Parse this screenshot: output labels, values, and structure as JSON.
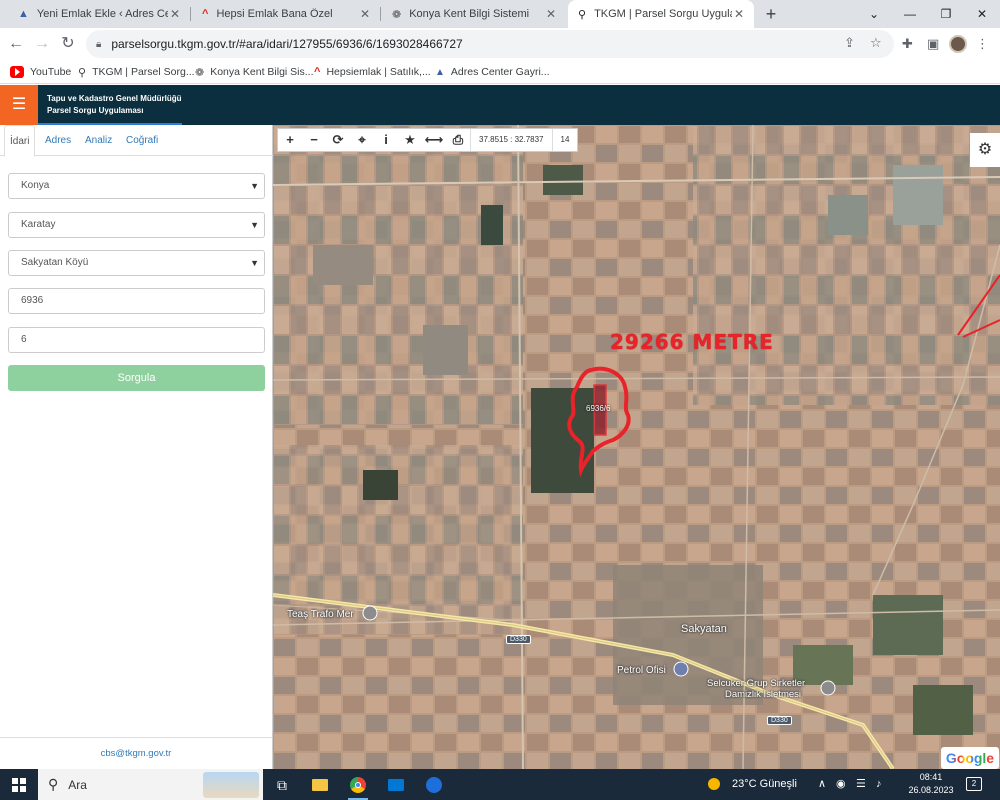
{
  "browser": {
    "tabs": [
      {
        "title": "Yeni Emlak Ekle ‹ Adres Center Gayri",
        "icon": "triangle-logo-icon",
        "active": false
      },
      {
        "title": "Hepsi Emlak Bana Özel",
        "icon": "hepsiemlak-icon",
        "active": false
      },
      {
        "title": "Konya Kent Bilgi Sistemi",
        "icon": "konya-logo-icon",
        "active": false
      },
      {
        "title": "TKGM | Parsel Sorgu Uygulaması",
        "icon": "map-pin-icon",
        "active": true
      }
    ],
    "new_tab": "+",
    "window_controls": {
      "dropdown": "⌄",
      "minimize": "—",
      "restore": "❐",
      "close": "✕"
    },
    "url": "parselsorgu.tkgm.gov.tr/#ara/idari/127955/6936/6/1693028466727",
    "bookmarks": [
      {
        "label": "YouTube",
        "icon": "youtube-icon"
      },
      {
        "label": "TKGM | Parsel Sorg...",
        "icon": "map-pin-icon"
      },
      {
        "label": "Konya Kent Bilgi Sis...",
        "icon": "konya-logo-icon"
      },
      {
        "label": "Hepsiemlak | Satılık,...",
        "icon": "hepsiemlak-icon"
      },
      {
        "label": "Adres Center Gayri...",
        "icon": "triangle-logo-icon"
      }
    ]
  },
  "app": {
    "title_line1": "Tapu ve Kadastro Genel Müdürlüğü",
    "title_line2": "Parsel Sorgu Uygulaması",
    "menu_icon": "☰",
    "colors": {
      "header": "#0b2f3f",
      "menu": "#f26522",
      "query_button": "#8fd19e",
      "annotation": "#e8232a"
    }
  },
  "sidebar": {
    "tabs": [
      "İdari",
      "Adres",
      "Analiz",
      "Coğrafi"
    ],
    "active_tab": "İdari",
    "province": "Konya",
    "district": "Karatay",
    "neighborhood": "Sakyatan Köyü",
    "block": "6936",
    "parcel": "6",
    "query_button": "Sorgula",
    "footer_email": "cbs@tkgm.gov.tr"
  },
  "map": {
    "tools": {
      "zoom_in": "+",
      "zoom_out": "−",
      "refresh": "⟳",
      "locate": "⌖",
      "info": "i",
      "favorite": "★",
      "measure": "⟷",
      "print": "⎙"
    },
    "coordinates": "37.8515 : 32.7837",
    "zoom": "14",
    "settings_icon": "⚙",
    "annotation_text": "29266 METRE",
    "parcel_label": "6936/6",
    "labels": {
      "trafo": "Teaş Trafo Mer",
      "village": "Sakyatan",
      "petrol": "Petrol Ofisi",
      "selcuker_line1": "Selcuker Grup Sirketler",
      "selcuker_line2": "Damizlik Isletmesi",
      "road1": "D330",
      "road2": "D330"
    },
    "attribution": "Google"
  },
  "taskbar": {
    "search_placeholder": "Ara",
    "weather": "23°C  Güneşli",
    "time": "08:41",
    "date": "26.08.2023",
    "notifications": "2"
  }
}
